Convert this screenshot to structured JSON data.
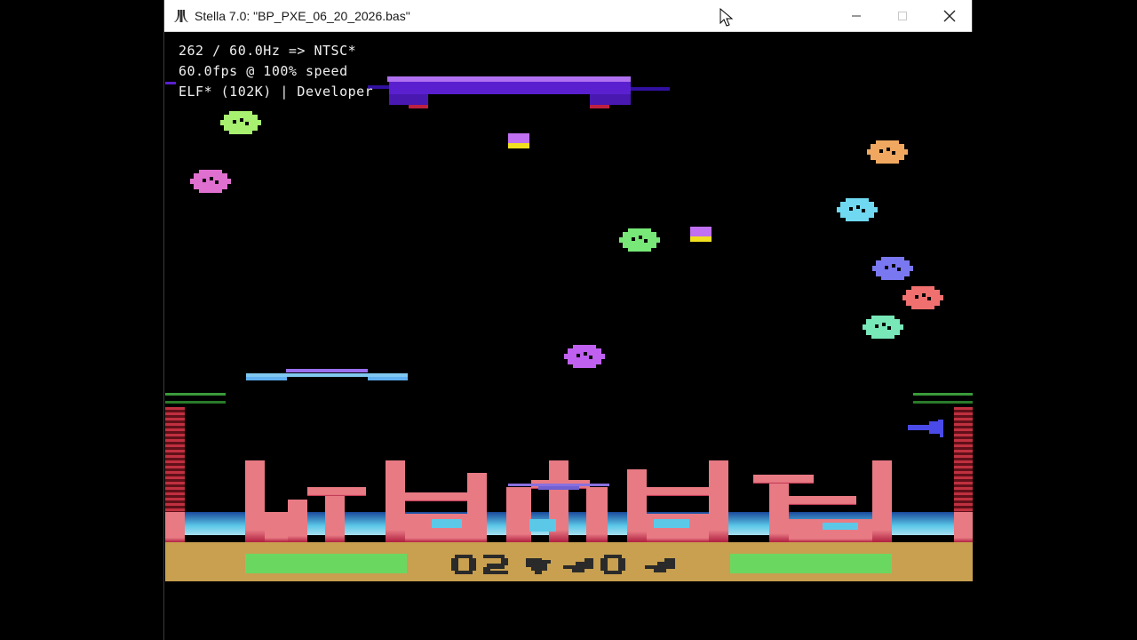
{
  "window": {
    "title": "Stella 7.0: \"BP_PXE_06_20_2026.bas\"",
    "minimize_icon": "minimize-icon",
    "maximize_icon": "maximize-icon",
    "close_icon": "close-icon",
    "app_icon": "atari-logo-icon"
  },
  "osd": {
    "line1": "262 / 60.0Hz => NTSC*",
    "line2": "60.0fps @ 100% speed",
    "line3": "ELF* (102K) | Developer"
  },
  "game": {
    "score_digits": "02",
    "lives_remaining": 3,
    "palette": {
      "ground": "#c8a050",
      "cityscape": "#e87a84",
      "horizon": "#5cc8e8",
      "energy_bar": "#6ad860",
      "mothership": "#8a3af0",
      "player_ship": "#4a4ae8"
    },
    "enemies": [
      {
        "name": "enemy-green",
        "color": "#a8f070"
      },
      {
        "name": "enemy-pink",
        "color": "#e070d0"
      },
      {
        "name": "enemy-orange",
        "color": "#f0a860"
      },
      {
        "name": "enemy-cyan",
        "color": "#70d8f0"
      },
      {
        "name": "enemy-green-2",
        "color": "#78e878"
      },
      {
        "name": "enemy-blue",
        "color": "#7a78f0"
      },
      {
        "name": "enemy-red",
        "color": "#f07070"
      },
      {
        "name": "enemy-teal",
        "color": "#78e8b8"
      },
      {
        "name": "enemy-purple",
        "color": "#c060f0"
      }
    ]
  }
}
